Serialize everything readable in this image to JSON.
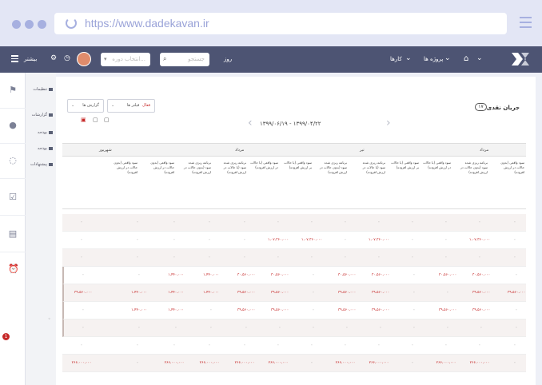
{
  "browser": {
    "url": "https://www.dadekavan.ir"
  },
  "nav": {
    "more_label": "بیشتر",
    "select_placeholder": "انتخاب دوره...",
    "search_placeholder": "جستجو",
    "day_label": "روز",
    "links": [
      "کارها",
      "پروژه ها"
    ]
  },
  "sidebar": {
    "items": [
      "تنظیمات",
      "گزارشات",
      "بودجه",
      "بودجه",
      "پیشنهادات"
    ],
    "badge": "1"
  },
  "page": {
    "title": "جریان نقدی",
    "count": "۱۷",
    "date_range": "۱۳۹۹/۰۶/۱۹ - ۱۳۹۹/۰۴/۲۲",
    "filter_report_label": "گزارش ها",
    "filter_type_label": "فیلتر ها",
    "filter_type_value": "فعال"
  },
  "table": {
    "months": [
      {
        "label": "مرداد"
      },
      {
        "label": "تیر"
      },
      {
        "label": "مرداد"
      },
      {
        "label": "شهریور"
      }
    ],
    "columns": [
      "سود واقعی (بدون حالات در ارزش افزوده)",
      "برنامه ریزی شده سود (بدون حالات در ارزش افزوده)",
      "سود واقعی (با حالات در ارزش افزوده)",
      "سود واقعی (با حالات بر ارزش افزوده)",
      "برنامه ریزی شده سود (با حالات در ارزش افزوده)",
      "برنامه ریزی شده سود (بدون حالات در ارزش افزوده)",
      "سود واقعی (با حالات بر ارزش افزوده)",
      "سود واقعی (با حالات در ارزش افزوده)",
      "برنامه ریزی شده سود (با حالات در ارزش افزوده)",
      "برنامه ریزی شده سود (بدون حالات در ارزش افزوده)",
      "سود واقعی (بدون حالات در ارزش افزوده)",
      "سود واقعی (بدون حالات در ارزش افزوده)"
    ],
    "rows": [
      {
        "shade": true,
        "cells": [
          "۰",
          "۰",
          "۰",
          "۰",
          "۰",
          "۰",
          "۰",
          "۰",
          "۰",
          "۰",
          "۰",
          "۰",
          "۰"
        ]
      },
      {
        "shade": false,
        "cells": [
          "۰",
          "۱،۰۷،۳۶۰،۰۰۰",
          "۰",
          "۰",
          "۱،۰۷،۳۶۰،۰۰۰",
          "۰",
          "۱،۰۷،۳۶۰،۰۰۰",
          "۱،۰۷،۳۶۰،۰۰۰",
          "۰",
          "۰",
          "۰",
          "۰",
          "۰"
        ]
      },
      {
        "shade": true,
        "cells": [
          "۰",
          "۰",
          "۰",
          "۰",
          "۰",
          "۰",
          "۰",
          "۰",
          "۰",
          "۰",
          "۰",
          "۰",
          "۰"
        ]
      },
      {
        "shade": false,
        "cells": [
          "۰",
          "۳۰،۵۶۰،۰۰۰",
          "۳۰،۵۶۰،۰۰۰",
          "۰",
          "۳۰،۵۶۰،۰۰۰",
          "۳۰،۵۶۰،۰۰۰",
          "۰",
          "۳۰،۵۶۰،۰۰۰",
          "۳۰،۵۶۰،۰۰۰",
          "۱،۴۴۰،۰۰۰",
          "۱،۴۴۰،۰۰۰",
          "۰",
          "۰"
        ]
      },
      {
        "shade": true,
        "cells": [
          "۳۹،۵۶۰،۰۰۰",
          "۳۹،۵۶۰،۰۰۰",
          "۰",
          "۰",
          "۳۹،۵۶۰،۰۰۰",
          "۳۹،۵۶۰،۰۰۰",
          "۰",
          "۳۹،۵۶۰،۰۰۰",
          "۳۹،۵۶۰،۰۰۰",
          "۱،۴۴۰،۰۰۰",
          "۱،۴۴۰،۰۰۰",
          "۱،۴۴۰،۰۰۰",
          "۳۹،۵۶۰،۰۰۰"
        ]
      },
      {
        "shade": false,
        "cells": [
          "۰",
          "۳۹،۵۶۰،۰۰۰",
          "۳۹،۵۶۰،۰۰۰",
          "۰",
          "۳۹،۵۶۰،۰۰۰",
          "۳۹،۵۶۰،۰۰۰",
          "۰",
          "۳۹،۵۶۰،۰۰۰",
          "۳۹،۵۶۰،۰۰۰",
          "۰",
          "۱،۴۴۰،۰۰۰",
          "۱،۴۴۰،۰۰۰",
          "۰"
        ]
      },
      {
        "shade": true,
        "cells": [
          "۰",
          "۰",
          "۰",
          "۰",
          "۰",
          "۰",
          "۰",
          "۰",
          "۰",
          "۰",
          "۰",
          "۰",
          "۰"
        ]
      },
      {
        "shade": false,
        "cells": [
          "۰",
          "۰",
          "۰",
          "۰",
          "۰",
          "۰",
          "۰",
          "۰",
          "۰",
          "۰",
          "۰",
          "۰",
          "۰"
        ]
      },
      {
        "shade": true,
        "cells": [
          "۰",
          "۲۶۶،۰۰۰،۰۰۰",
          "۲۶۶،۰۰۰،۰۰۰",
          "۰",
          "۲۶۶،۰۰۰،۰۰۰",
          "۲۶۶،۰۰۰،۰۰۰",
          "۰",
          "۲۶۶،۰۰۰،۰۰۰",
          "۲۶۶،۰۰۰،۰۰۰",
          "۲۶۶،۰۰۰،۰۰۰",
          "۲۶۶،۰۰۰،۰۰۰",
          "۰",
          "۲۶۶،۰۰۰،۰۰۰"
        ]
      }
    ]
  },
  "colors": {
    "accent": "#c62828",
    "nav_bg": "#4d5473",
    "chrome_bg": "#e3e6f5"
  }
}
